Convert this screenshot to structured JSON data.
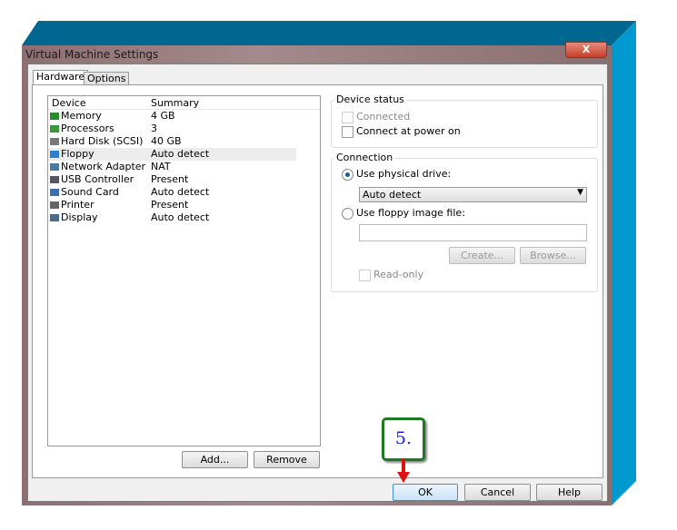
{
  "window": {
    "title": "Virtual Machine Settings",
    "close": "X"
  },
  "tabs": [
    {
      "label": "Hardware",
      "active": true
    },
    {
      "label": "Options",
      "active": false
    }
  ],
  "device_list": {
    "headers": [
      "Device",
      "Summary"
    ],
    "rows": [
      {
        "icon": "memory-icon",
        "device": "Memory",
        "summary": "4 GB"
      },
      {
        "icon": "processor-icon",
        "device": "Processors",
        "summary": "3"
      },
      {
        "icon": "hard-disk-icon",
        "device": "Hard Disk (SCSI)",
        "summary": "40 GB"
      },
      {
        "icon": "floppy-icon",
        "device": "Floppy",
        "summary": "Auto detect",
        "selected": true
      },
      {
        "icon": "network-adapter-icon",
        "device": "Network Adapter",
        "summary": "NAT"
      },
      {
        "icon": "usb-icon",
        "device": "USB Controller",
        "summary": "Present"
      },
      {
        "icon": "sound-card-icon",
        "device": "Sound Card",
        "summary": "Auto detect"
      },
      {
        "icon": "printer-icon",
        "device": "Printer",
        "summary": "Present"
      },
      {
        "icon": "display-icon",
        "device": "Display",
        "summary": "Auto detect"
      }
    ]
  },
  "list_buttons": {
    "add": "Add...",
    "remove": "Remove"
  },
  "device_status": {
    "title": "Device status",
    "connected": "Connected",
    "connect_at_power_on": "Connect at power on"
  },
  "connection": {
    "title": "Connection",
    "physical": "Use physical drive:",
    "physical_selected": true,
    "drive_value": "Auto detect",
    "image": "Use floppy image file:",
    "image_value": "",
    "create": "Create...",
    "browse": "Browse...",
    "read_only": "Read-only"
  },
  "footer": {
    "ok": "OK",
    "cancel": "Cancel",
    "help": "Help"
  },
  "callout": {
    "label": "5.",
    "border_color": "#1e7a1e",
    "arrow_color": "#e01010"
  },
  "colors": {
    "frame_top": "#006890",
    "frame_side": "#0099d0"
  }
}
